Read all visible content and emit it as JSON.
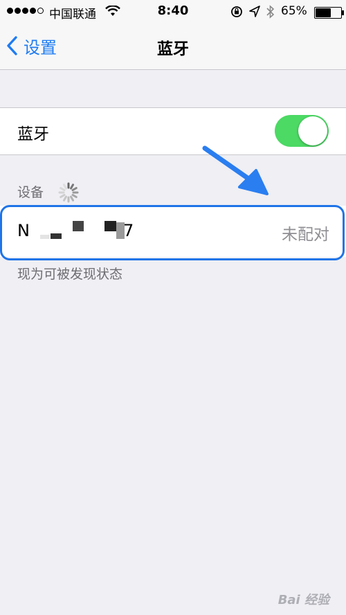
{
  "status_bar": {
    "carrier": "中国联通",
    "time": "8:40",
    "battery_percent_label": "65%",
    "battery_level": 0.65,
    "signal_bars_filled": 4,
    "signal_bars_total": 5
  },
  "nav_bar": {
    "back_label": "设置",
    "title": "蓝牙"
  },
  "bluetooth_cell": {
    "label": "蓝牙",
    "toggle_on": true
  },
  "devices_section": {
    "header": "设备",
    "devices": [
      {
        "name_prefix": "N",
        "name_suffix": "7",
        "status": "未配对"
      }
    ],
    "footer": "现为可被发现状态"
  },
  "watermark": "Bai 经验",
  "colors": {
    "accent": "#1e7cf2",
    "toggle_on": "#4cd964",
    "highlight": "#1f74e8",
    "background": "#efeff4"
  }
}
